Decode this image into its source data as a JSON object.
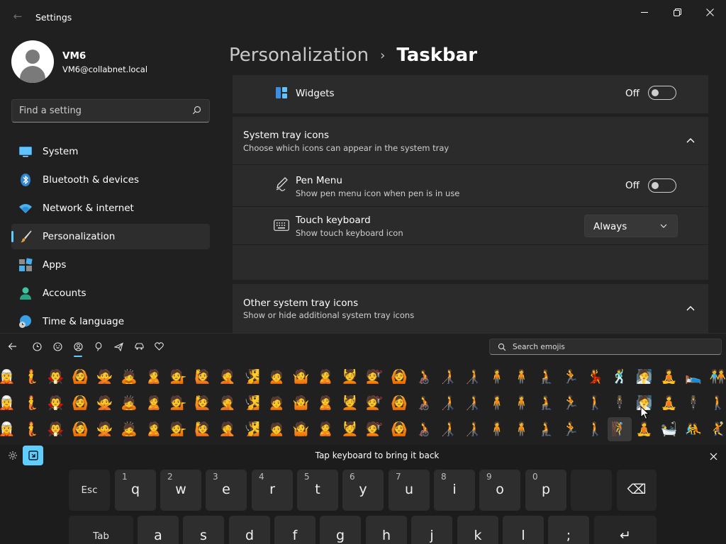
{
  "window": {
    "title": "Settings"
  },
  "profile": {
    "name": "VM6",
    "email": "VM6@collabnet.local"
  },
  "search": {
    "placeholder": "Find a setting"
  },
  "nav": {
    "items": [
      {
        "label": "System",
        "icon": "monitor-icon"
      },
      {
        "label": "Bluetooth & devices",
        "icon": "bluetooth-icon"
      },
      {
        "label": "Network & internet",
        "icon": "wifi-icon"
      },
      {
        "label": "Personalization",
        "icon": "brush-icon",
        "active": true
      },
      {
        "label": "Apps",
        "icon": "apps-icon"
      },
      {
        "label": "Accounts",
        "icon": "person-icon"
      },
      {
        "label": "Time & language",
        "icon": "globe-clock-icon"
      }
    ]
  },
  "breadcrumb": {
    "parent": "Personalization",
    "separator": "›",
    "current": "Taskbar"
  },
  "widgets": {
    "label": "Widgets",
    "state": "Off"
  },
  "system_tray": {
    "title": "System tray icons",
    "subtitle": "Choose which icons can appear in the system tray",
    "pen_menu": {
      "title": "Pen Menu",
      "subtitle": "Show pen menu icon when pen is in use",
      "state": "Off"
    },
    "touch_keyboard": {
      "title": "Touch keyboard",
      "subtitle": "Show touch keyboard icon",
      "value": "Always"
    }
  },
  "other_tray": {
    "title": "Other system tray icons",
    "subtitle": "Show or hide additional system tray icons"
  },
  "emoji_panel": {
    "search_placeholder": "Search emojis",
    "tabs": [
      "back-arrow-icon",
      "recent-clock-icon",
      "smiley-icon",
      "person-emoji-icon",
      "balloon-icon",
      "airplane-icon",
      "car-icon",
      "heart-icon"
    ],
    "active_tab": 3,
    "rows": [
      [
        "🧝",
        "🧜",
        "🧛",
        "🙆",
        "🙅",
        "🙇",
        "🙎",
        "💁",
        "🙋",
        "🤦",
        "🧏",
        "🙍",
        "🤷",
        "🙎",
        "💆",
        "💇",
        "🙆",
        "🧑‍🦽",
        "🧑‍🦯",
        "🧑‍🦯",
        "🧍",
        "🧍",
        "🧎",
        "🏃",
        "💃",
        "🕺",
        "🧖",
        "🧘",
        "🛌",
        "🧑‍🤝‍🧑",
        "👯",
        "🤸",
        "🏄"
      ],
      [
        "🧝",
        "🧜",
        "🧛",
        "🙆",
        "🙅",
        "🙇",
        "🙎",
        "💁",
        "🙋",
        "🤦",
        "🧏",
        "🙍",
        "🤷",
        "🙎",
        "💆",
        "💇",
        "🙆",
        "🧑‍🦽",
        "🧑‍🦯",
        "🧑‍🦯",
        "🧍",
        "🧍",
        "🧎",
        "🏃",
        "🚶",
        "🕴",
        "🧖",
        "🧘",
        "🕴",
        "🚶",
        "🏌",
        "🏄",
        "🚣"
      ],
      [
        "🧝",
        "🧜",
        "🧛",
        "🙆",
        "🙅",
        "🙇",
        "🙎",
        "💁",
        "🙋",
        "🤦",
        "🧏",
        "🙍",
        "🤷",
        "🙎",
        "💆",
        "💇",
        "🙆",
        "🧑‍🦽",
        "🧑‍🦯",
        "🧑‍🦯",
        "🧍",
        "🧍",
        "🧎",
        "🏃",
        "🚶",
        "🧗",
        "🧘",
        "🛀",
        "🤼",
        "🤾",
        "🏄",
        "🚣",
        "🚵"
      ]
    ]
  },
  "keyboard": {
    "hint": "Tap keyboard to bring it back",
    "row1": [
      {
        "main": "Esc",
        "alt": ""
      },
      {
        "main": "q",
        "alt": "1"
      },
      {
        "main": "w",
        "alt": "2"
      },
      {
        "main": "e",
        "alt": "3"
      },
      {
        "main": "r",
        "alt": "4"
      },
      {
        "main": "t",
        "alt": "5"
      },
      {
        "main": "y",
        "alt": "6"
      },
      {
        "main": "u",
        "alt": "7"
      },
      {
        "main": "i",
        "alt": "8"
      },
      {
        "main": "o",
        "alt": "9"
      },
      {
        "main": "p",
        "alt": "0"
      },
      {
        "main": "",
        "alt": ""
      },
      {
        "main": "⌫",
        "alt": ""
      }
    ],
    "row2": [
      {
        "main": "Tab",
        "alt": ""
      },
      {
        "main": "a",
        "alt": ""
      },
      {
        "main": "s",
        "alt": ""
      },
      {
        "main": "d",
        "alt": ""
      },
      {
        "main": "f",
        "alt": ""
      },
      {
        "main": "g",
        "alt": ""
      },
      {
        "main": "h",
        "alt": ""
      },
      {
        "main": "j",
        "alt": ""
      },
      {
        "main": "k",
        "alt": ""
      },
      {
        "main": "l",
        "alt": ""
      },
      {
        "main": ";",
        "alt": ""
      },
      {
        "main": "↵",
        "alt": ""
      }
    ]
  },
  "colors": {
    "accent": "#60cdff",
    "background": "#202020",
    "card": "#2b2b2b"
  }
}
